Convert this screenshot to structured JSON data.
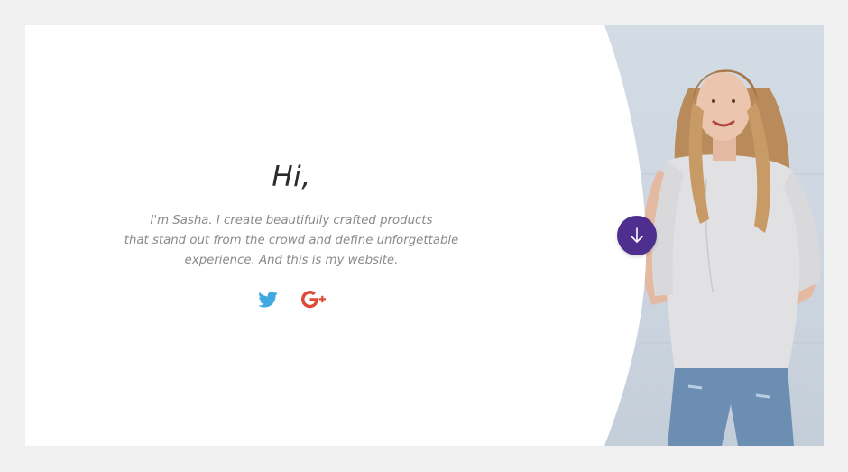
{
  "hero": {
    "greeting": "Hi,",
    "intro_lines": [
      "I'm Sasha. I create beautifully crafted products",
      "that stand out from the crowd and define unforgettable",
      "experience. And this is my website."
    ]
  },
  "social": {
    "twitter": {
      "icon": "twitter-icon",
      "color": "#3fa9e0"
    },
    "google_plus": {
      "icon": "google-plus-icon",
      "color": "#dc4a38"
    }
  },
  "scroll_button": {
    "icon": "arrow-down-icon",
    "color": "#4e2f8f"
  },
  "theme": {
    "page_background": "#f0f0f0",
    "card_background": "#ffffff",
    "photo_background": "#d3dbe5"
  }
}
